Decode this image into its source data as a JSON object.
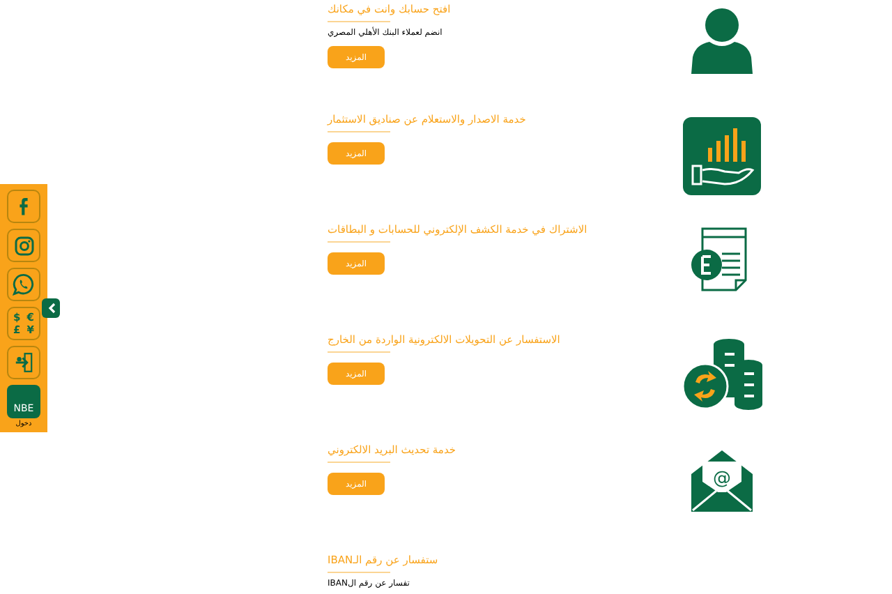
{
  "services": [
    {
      "kind": "person",
      "title": "افتح حسابك وانت في مكانك",
      "description": "انضم لعملاء البنك الأهلي المصري",
      "button": "المزيد"
    },
    {
      "kind": "invest",
      "title": "خدمة الاصدار والاستعلام عن صناديق الاستثمار",
      "button": "المزيد"
    },
    {
      "kind": "statement",
      "title": "الاشتراك في خدمة الكشف الإلكتروني للحسابات و البطاقات",
      "button": "المزيد"
    },
    {
      "kind": "coins",
      "title": "الاستفسار عن التحويلات الالكترونية الواردة من الخارج",
      "button": "المزيد"
    },
    {
      "kind": "mail",
      "title": "خدمة تحديث البريد الالكتروني",
      "button": "المزيد",
      "symbol": "@"
    },
    {
      "kind": "none",
      "title": "ستفسار عن رقم الـIBAN",
      "description": "تفسار عن رقم الIBAN"
    }
  ],
  "sidebar": {
    "items": [
      {
        "kind": "facebook"
      },
      {
        "kind": "instagram"
      },
      {
        "kind": "whatsapp"
      },
      {
        "kind": "currency",
        "symbols": [
          "$ €",
          "£ ¥"
        ]
      },
      {
        "kind": "exit"
      },
      {
        "kind": "nbe",
        "badge": "NBE",
        "caption": "دخول"
      }
    ]
  }
}
